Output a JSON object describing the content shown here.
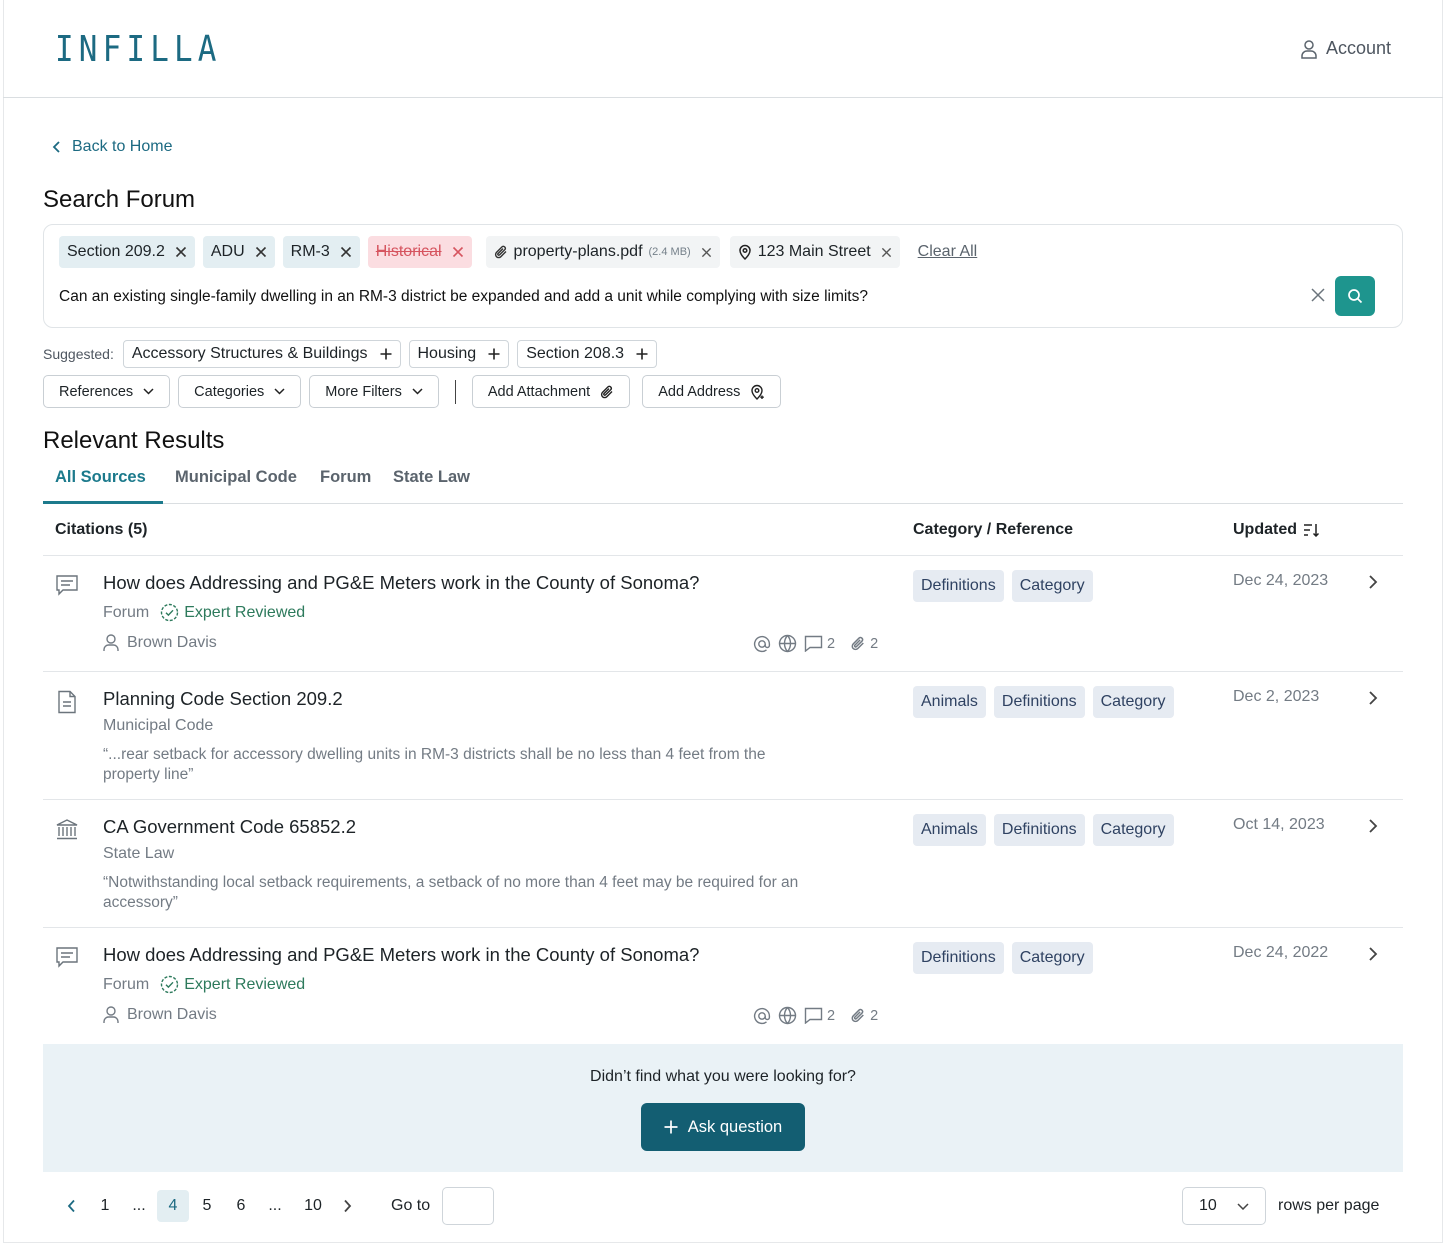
{
  "app": {
    "logo": "INFILLA",
    "account_label": "Account"
  },
  "nav": {
    "back_label": "Back to Home"
  },
  "search": {
    "title": "Search Forum",
    "chips": [
      {
        "label": "Section 209.2"
      },
      {
        "label": "ADU"
      },
      {
        "label": "RM-3"
      },
      {
        "label": "Historical"
      },
      {
        "label": "property-plans.pdf",
        "size": "(2.4 MB)"
      },
      {
        "label": "123 Main Street"
      }
    ],
    "clear_all": "Clear All",
    "query": "Can an existing single-family dwelling in an RM-3 district be expanded and add a unit while complying with size limits?"
  },
  "suggested": {
    "lead": "Suggested:",
    "items": [
      "Accessory Structures & Buildings",
      "Housing",
      "Section 208.3"
    ]
  },
  "filters": {
    "references": "References",
    "categories": "Categories",
    "more": "More Filters",
    "attachment": "Add Attachment",
    "address": "Add Address"
  },
  "results": {
    "title": "Relevant Results",
    "tabs": [
      "All Sources",
      "Municipal Code",
      "Forum",
      "State Law"
    ],
    "columns": {
      "citations": "Citations (5)",
      "category": "Category / Reference",
      "updated": "Updated"
    },
    "rows": [
      {
        "icon": "forum-message-icon",
        "title": "How does Addressing and PG&E Meters work in the County of Sonoma?",
        "source": "Forum",
        "badge": "Expert Reviewed",
        "author": "Brown Davis",
        "comments": "2",
        "attachments": "2",
        "tags": [
          "Definitions",
          "Category"
        ],
        "date": "Dec 24, 2023"
      },
      {
        "icon": "document-icon",
        "title": "Planning Code Section 209.2",
        "source": "Municipal Code",
        "quote": "“...rear setback for accessory dwelling units in RM-3 districts shall be no less than 4 feet from the property line”",
        "tags": [
          "Animals",
          "Definitions",
          "Category"
        ],
        "date": "Dec 2, 2023"
      },
      {
        "icon": "government-building-icon",
        "title": "CA Government Code 65852.2",
        "source": "State Law",
        "quote": "“Notwithstanding local setback requirements, a setback of no more than 4 feet may be required for an accessory”",
        "tags": [
          "Animals",
          "Definitions",
          "Category"
        ],
        "date": "Oct 14, 2023"
      },
      {
        "icon": "forum-message-icon",
        "title": "How does Addressing and PG&E Meters work in the County of Sonoma?",
        "source": "Forum",
        "badge": "Expert Reviewed",
        "author": "Brown Davis",
        "comments": "2",
        "attachments": "2",
        "tags": [
          "Definitions",
          "Category"
        ],
        "date": "Dec 24, 2022"
      }
    ]
  },
  "ask": {
    "prompt": "Didn’t find what you were looking for?",
    "button": "Ask question"
  },
  "pagination": {
    "pages": [
      "1",
      "...",
      "4",
      "5",
      "6",
      "...",
      "10"
    ],
    "current": "4",
    "goto_label": "Go to",
    "rows_value": "10",
    "rows_label": "rows per page"
  },
  "colors": {
    "brand": "#1c6a82",
    "accent": "#1e958e",
    "button": "#135e72"
  }
}
